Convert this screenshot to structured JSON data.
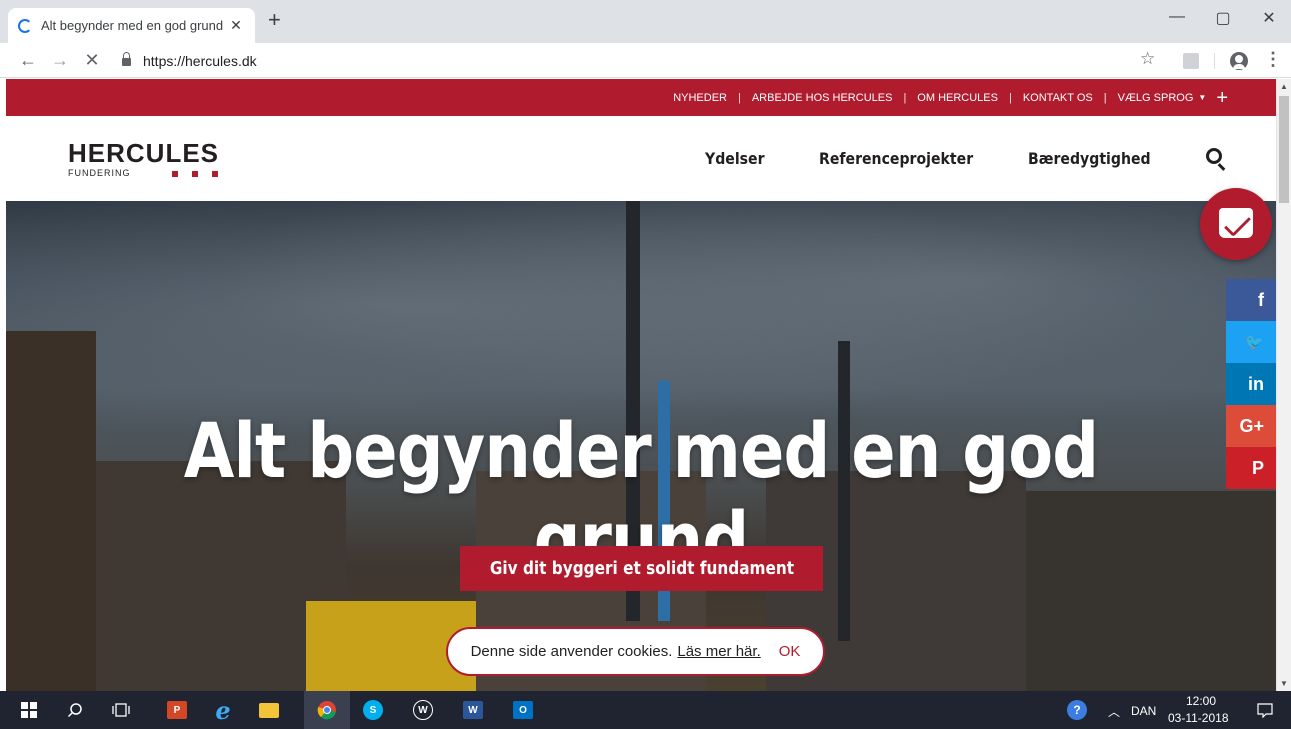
{
  "browser": {
    "tab_title": "Alt begynder med en god grund",
    "tab_close": "✕",
    "new_tab": "+",
    "url": "https://hercules.dk",
    "window_controls": {
      "minimize": "—",
      "maximize": "▢",
      "close": "✕"
    },
    "nav": {
      "back": "←",
      "forward": "→",
      "stop": "✕"
    },
    "star": "☆",
    "menu": "⋮"
  },
  "topbar": {
    "items": [
      "NYHEDER",
      "ARBEJDE HOS HERCULES",
      "OM HERCULES",
      "KONTAKT OS",
      "VÆLG SPROG"
    ],
    "separator": "|",
    "caret": "▼",
    "plus": "+"
  },
  "header": {
    "logo_main": "HERCULES",
    "logo_sub": "FUNDERING",
    "nav": [
      "Ydelser",
      "Referenceprojekter",
      "Bæredygtighed"
    ]
  },
  "hero": {
    "title": "Alt begynder med en god grund",
    "cta": "Giv dit byggeri et solidt fundament"
  },
  "cookie": {
    "text": "Denne side anvender cookies.",
    "link": "Läs mer här.",
    "ok": "OK"
  },
  "social": [
    {
      "icon": "facebook-icon",
      "glyph": "f",
      "color": "#3b5998"
    },
    {
      "icon": "twitter-icon",
      "glyph": "🐦",
      "color": "#1da1f2"
    },
    {
      "icon": "linkedin-icon",
      "glyph": "in",
      "color": "#0077b5"
    },
    {
      "icon": "google-plus-icon",
      "glyph": "G+",
      "color": "#dd4b39"
    },
    {
      "icon": "pinterest-icon",
      "glyph": "P",
      "color": "#cb2027"
    }
  ],
  "taskbar": {
    "language": "DAN",
    "time": "12:00",
    "date": "03-11-2018"
  },
  "colors": {
    "brand_red": "#b01c2e",
    "taskbar": "#1f2430"
  }
}
